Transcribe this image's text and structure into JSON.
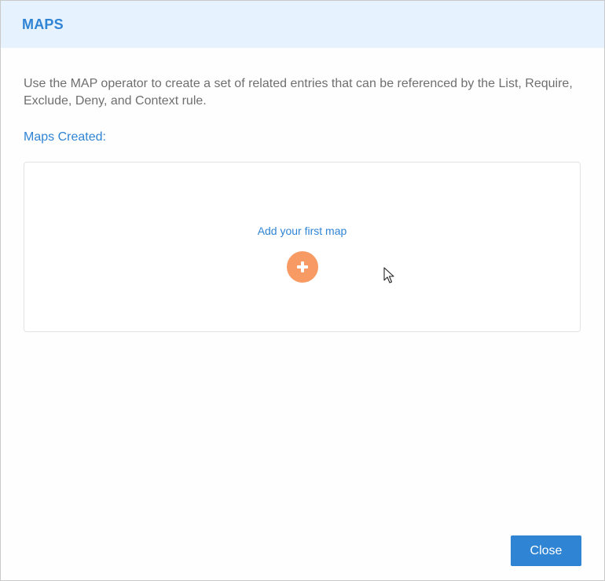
{
  "dialog": {
    "title": "MAPS",
    "description": "Use the MAP operator to create a set of related entries that can be referenced by the List, Require, Exclude, Deny, and Context rule.",
    "maps_created_label": "Maps Created:",
    "empty_state": {
      "add_first_label": "Add your first map",
      "add_button_icon": "plus-icon"
    },
    "close_label": "Close"
  },
  "colors": {
    "header_bg": "#e6f2fe",
    "accent": "#2f84d4",
    "add_button": "#f79a63",
    "body_text": "#6f6f6f"
  },
  "cursor_icon": "arrow-cursor-icon"
}
